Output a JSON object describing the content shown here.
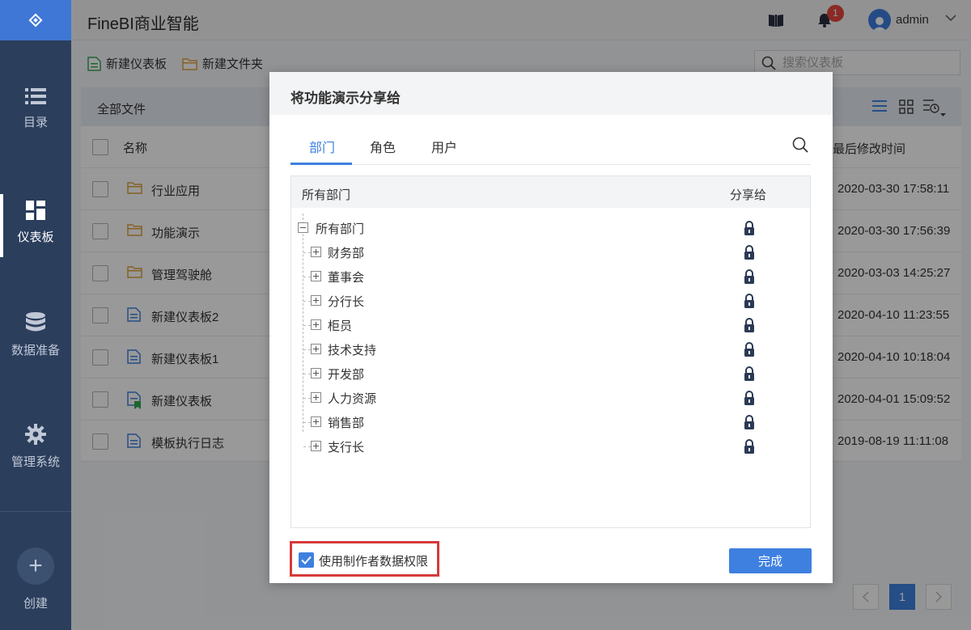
{
  "app": {
    "title": "FineBI商业智能"
  },
  "sidebar": {
    "items": [
      {
        "label": "目录",
        "icon": "list-icon"
      },
      {
        "label": "仪表板",
        "icon": "dashboard-icon"
      },
      {
        "label": "数据准备",
        "icon": "database-icon"
      },
      {
        "label": "管理系统",
        "icon": "gear-icon"
      }
    ],
    "create_label": "创建",
    "create_glyph": "+"
  },
  "header": {
    "notification_count": "1",
    "username": "admin"
  },
  "toolbar": {
    "new_dashboard": "新建仪表板",
    "new_folder": "新建文件夹",
    "search_placeholder": "搜索仪表板"
  },
  "file_panel": {
    "breadcrumb": "全部文件",
    "columns": {
      "name": "名称",
      "modified": "最后修改时间"
    },
    "rows": [
      {
        "name": "行业应用",
        "type": "folder",
        "modified": "2020-03-30 17:58:11"
      },
      {
        "name": "功能演示",
        "type": "folder",
        "modified": "2020-03-30 17:56:39"
      },
      {
        "name": "管理驾驶舱",
        "type": "folder",
        "modified": "2020-03-03 14:25:27"
      },
      {
        "name": "新建仪表板2",
        "type": "dashboard",
        "modified": "2020-04-10 11:23:55"
      },
      {
        "name": "新建仪表板1",
        "type": "dashboard",
        "modified": "2020-04-10 10:18:04"
      },
      {
        "name": "新建仪表板",
        "type": "dashboard-shared",
        "modified": "2020-04-01 15:09:52"
      },
      {
        "name": "模板执行日志",
        "type": "dashboard",
        "modified": "2019-08-19 11:11:08"
      }
    ],
    "pagination": {
      "current_page": "1"
    }
  },
  "dialog": {
    "title": "将功能演示分享给",
    "tabs": [
      {
        "label": "部门"
      },
      {
        "label": "角色"
      },
      {
        "label": "用户"
      }
    ],
    "active_tab": "部门",
    "tree": {
      "header_left": "所有部门",
      "header_right": "分享给",
      "root": "所有部门",
      "children": [
        {
          "label": "财务部"
        },
        {
          "label": "董事会"
        },
        {
          "label": "分行长"
        },
        {
          "label": "柜员"
        },
        {
          "label": "技术支持"
        },
        {
          "label": "开发部"
        },
        {
          "label": "人力资源"
        },
        {
          "label": "销售部"
        },
        {
          "label": "支行长"
        }
      ]
    },
    "use_creator_permission": {
      "label": "使用制作者数据权限",
      "checked": true
    },
    "done_button": "完成"
  },
  "colors": {
    "accent": "#3e80e0",
    "sidebar_bg": "#2b3e5c",
    "highlight_border": "#d63a3a",
    "badge": "#e4473e"
  }
}
